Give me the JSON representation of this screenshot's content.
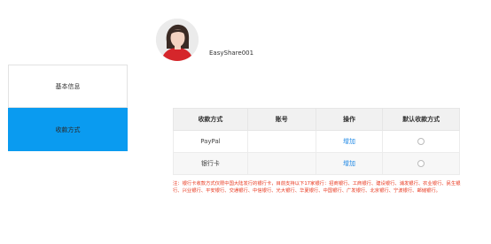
{
  "profile": {
    "username": "EasyShare001"
  },
  "sidebar": {
    "items": [
      {
        "label": "基本信息"
      },
      {
        "label": "收款方式"
      }
    ],
    "active_color": "#0a9bf0"
  },
  "table": {
    "headers": [
      "收款方式",
      "账号",
      "操作",
      "默认收款方式"
    ],
    "rows": [
      {
        "method": "PayPal",
        "account": "",
        "action": "增加"
      },
      {
        "method": "银行卡",
        "account": "",
        "action": "增加"
      }
    ]
  },
  "note": "注：银行卡收款方式仅限中国大陆发行的银行卡，目前支持以下17家银行：招商银行、工商银行、建设银行、浦发银行、农业银行、民生银行、兴业银行、平安银行、交通银行、中信银行、光大银行、华夏银行、中国银行、广发银行、北京银行、宁波银行、邮储银行。",
  "colors": {
    "link": "#1e88e5",
    "note": "#e8361c"
  }
}
